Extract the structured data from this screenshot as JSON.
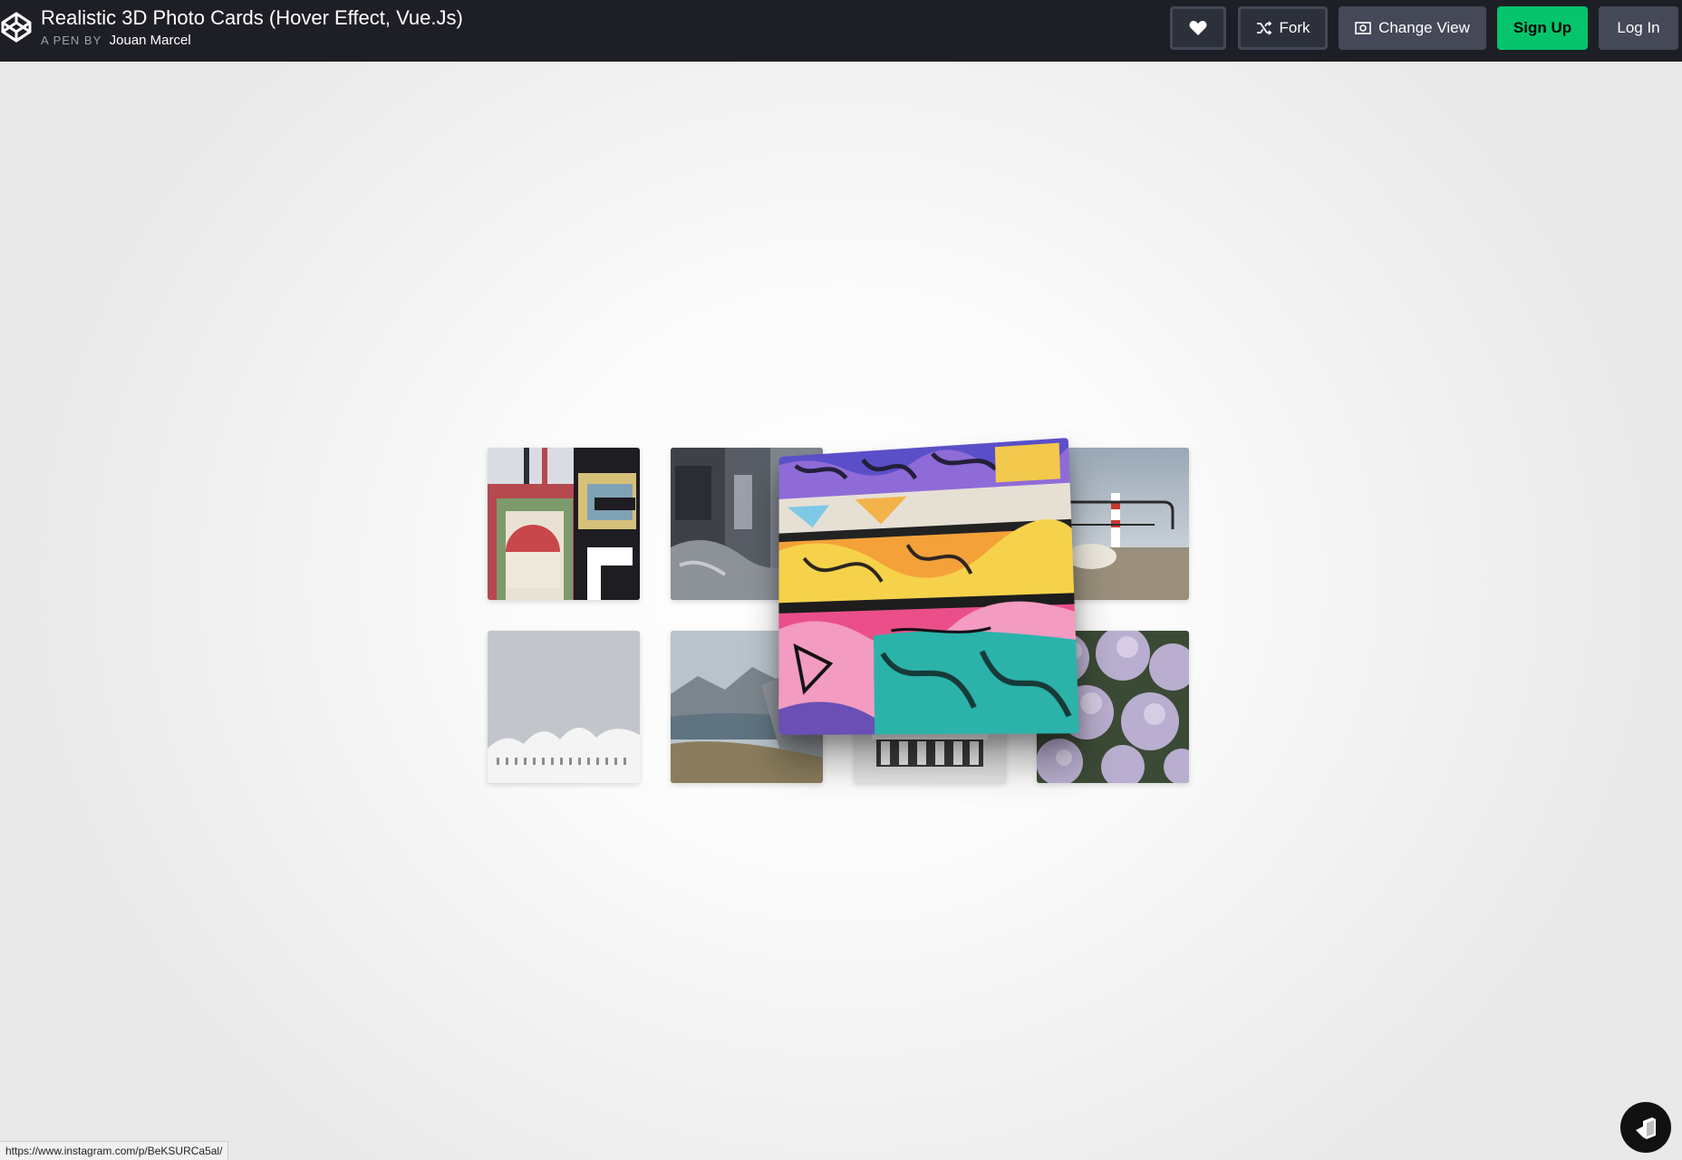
{
  "header": {
    "title": "Realistic 3D Photo Cards (Hover Effect, Vue.Js)",
    "byline_prefix": "A PEN BY",
    "author": "Jouan Marcel",
    "buttons": {
      "fork": "Fork",
      "change_view": "Change View",
      "sign_up": "Sign Up",
      "log_in": "Log In"
    }
  },
  "icons": {
    "logo": "codepen-logo-icon",
    "heart": "heart-icon",
    "fork": "fork-icon",
    "change_view": "eye-icon",
    "floating": "fab-icon"
  },
  "gallery": {
    "cards": [
      {
        "subject": "geometric-art"
      },
      {
        "subject": "graffiti-alley"
      },
      {
        "subject": "graffiti-wall-hovered"
      },
      {
        "subject": "lighthouse-sheep"
      },
      {
        "subject": "wavy-building"
      },
      {
        "subject": "mountain-lake"
      },
      {
        "subject": "pipe-organ"
      },
      {
        "subject": "hydrangeas"
      }
    ]
  },
  "status_url": "https://www.instagram.com/p/BeKSURCa5al/",
  "colors": {
    "topbar": "#1e1f26",
    "signup": "#05c46b",
    "button_dark": "#444857"
  }
}
